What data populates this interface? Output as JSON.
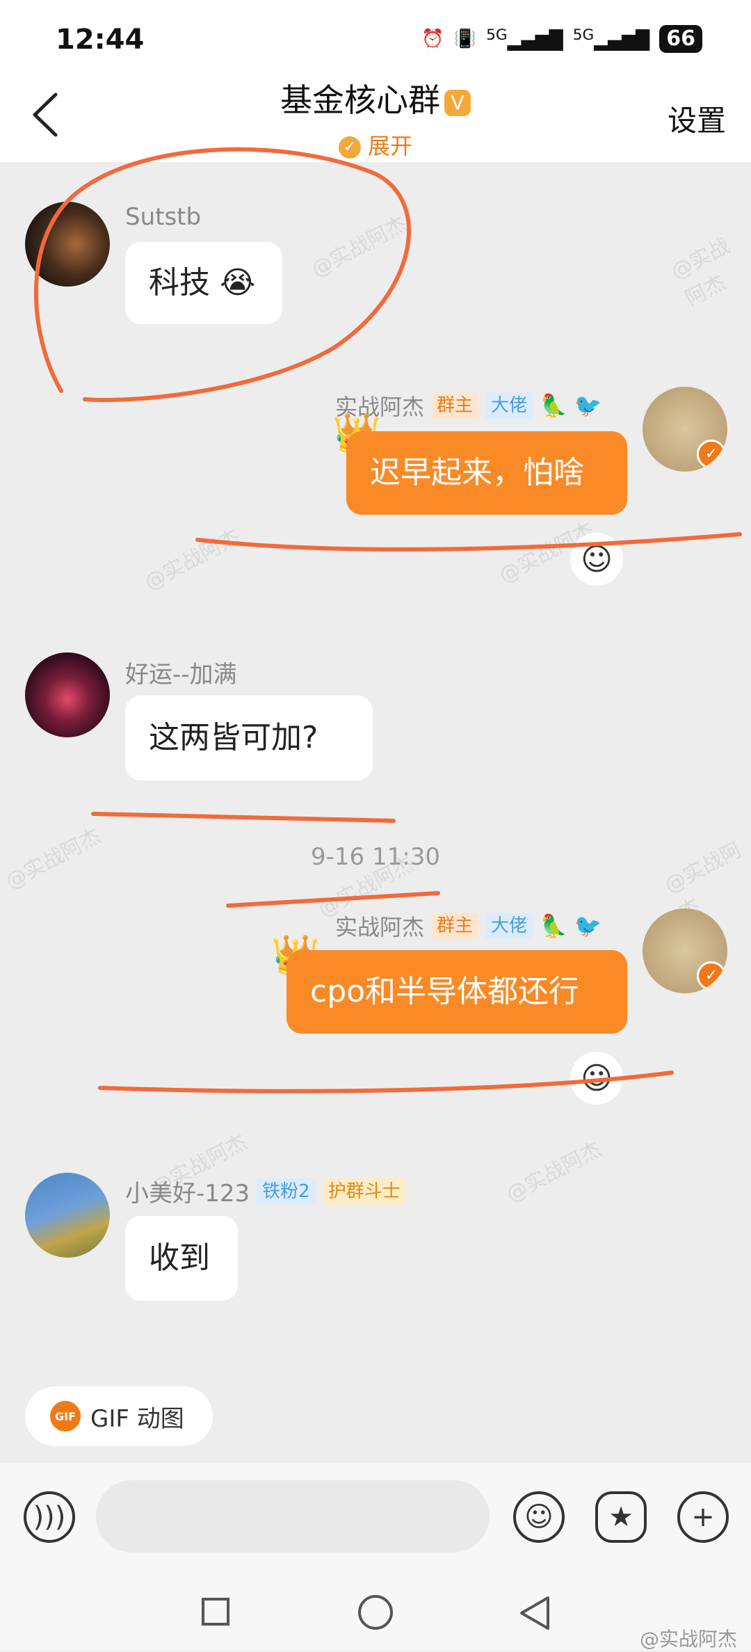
{
  "status_bar": {
    "time": "12:44",
    "network1": "5G",
    "network2": "5G",
    "battery": "66"
  },
  "header": {
    "title": "基金核心群",
    "expand_label": "展开",
    "settings_label": "设置",
    "badge_icon": "v-badge-icon"
  },
  "messages": [
    {
      "sender": "Sutstb",
      "text": "科技 😭",
      "side": "left"
    },
    {
      "sender": "实战阿杰",
      "tags": [
        "群主",
        "大佬"
      ],
      "text": "迟早起来，怕啥",
      "side": "right"
    },
    {
      "sender": "好运--加满",
      "text": "这两皆可加?",
      "side": "left"
    },
    {
      "sender": "实战阿杰",
      "tags": [
        "群主",
        "大佬"
      ],
      "text": "cpo和半导体都还行",
      "side": "right"
    },
    {
      "sender": "小美好-123",
      "tags": [
        "铁粉2",
        "护群斗士"
      ],
      "text": "收到",
      "side": "left"
    }
  ],
  "timestamps": [
    "9-16 11:30"
  ],
  "gif_button": {
    "label": "GIF 动图",
    "icon_text": "GIF"
  },
  "watermark": {
    "text": "@实战阿杰"
  },
  "colors": {
    "accent": "#fa8a26",
    "annotation": "#f26a3c",
    "background": "#ededed"
  }
}
